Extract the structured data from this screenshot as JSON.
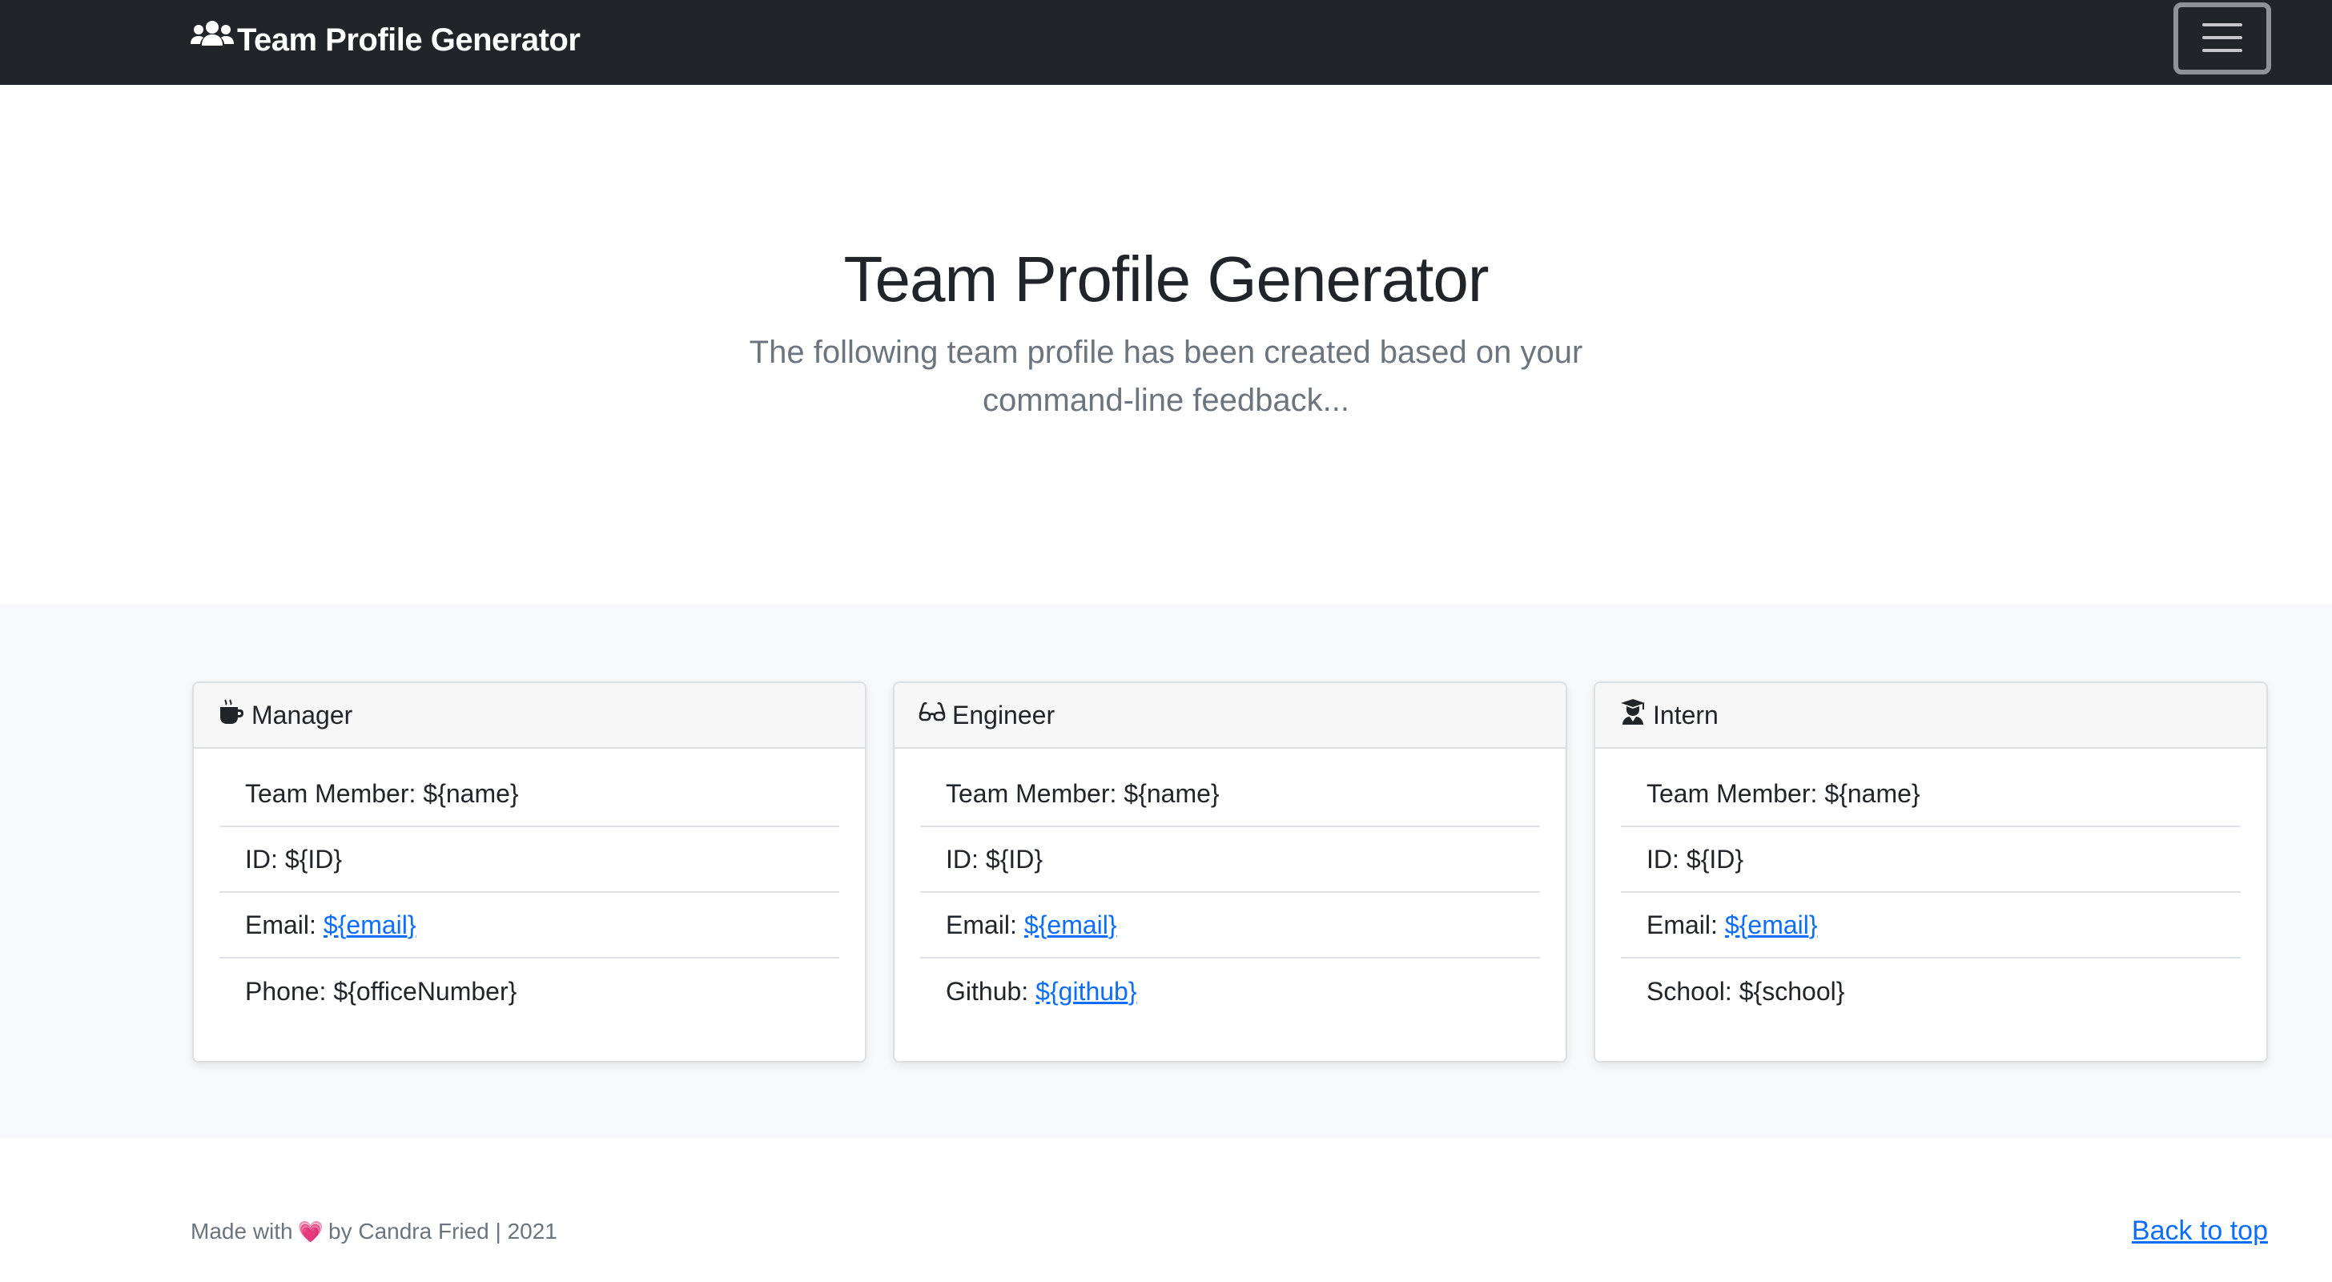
{
  "navbar": {
    "brand": "Team Profile Generator",
    "brand_icon": "users-icon",
    "toggler_icon": "hamburger-menu-icon"
  },
  "hero": {
    "title": "Team Profile Generator",
    "lead": "The following team profile has been created based on your command-line feedback..."
  },
  "cards": [
    {
      "title": "Manager",
      "icon": "coffee-mug-icon",
      "items": [
        {
          "label": "Team Member:",
          "value": "${name}"
        },
        {
          "label": "ID:",
          "value": "${ID}"
        },
        {
          "label": "Email:",
          "value": "${email}"
        },
        {
          "label": "Phone:",
          "value": "${officeNumber}"
        }
      ]
    },
    {
      "title": "Engineer",
      "icon": "glasses-icon",
      "items": [
        {
          "label": "Team Member:",
          "value": "${name}"
        },
        {
          "label": "ID:",
          "value": "${ID}"
        },
        {
          "label": "Email:",
          "value": "${email}"
        },
        {
          "label": "Github:",
          "value": "${github}"
        }
      ]
    },
    {
      "title": "Intern",
      "icon": "graduate-icon",
      "items": [
        {
          "label": "Team Member:",
          "value": "${name}"
        },
        {
          "label": "ID:",
          "value": "${ID}"
        },
        {
          "label": "Email:",
          "value": "${email}"
        },
        {
          "label": "School:",
          "value": "${school}"
        }
      ]
    }
  ],
  "footer": {
    "made_with": "Made with",
    "heart": "💗",
    "by": "by Candra Fried | 2021",
    "back_to_top": "Back to top"
  },
  "colors": {
    "navbar_bg": "#212529",
    "section_bg": "#f8f9fa",
    "link": "#0d6efd",
    "muted": "#6c757d",
    "heart": "#e84393"
  }
}
